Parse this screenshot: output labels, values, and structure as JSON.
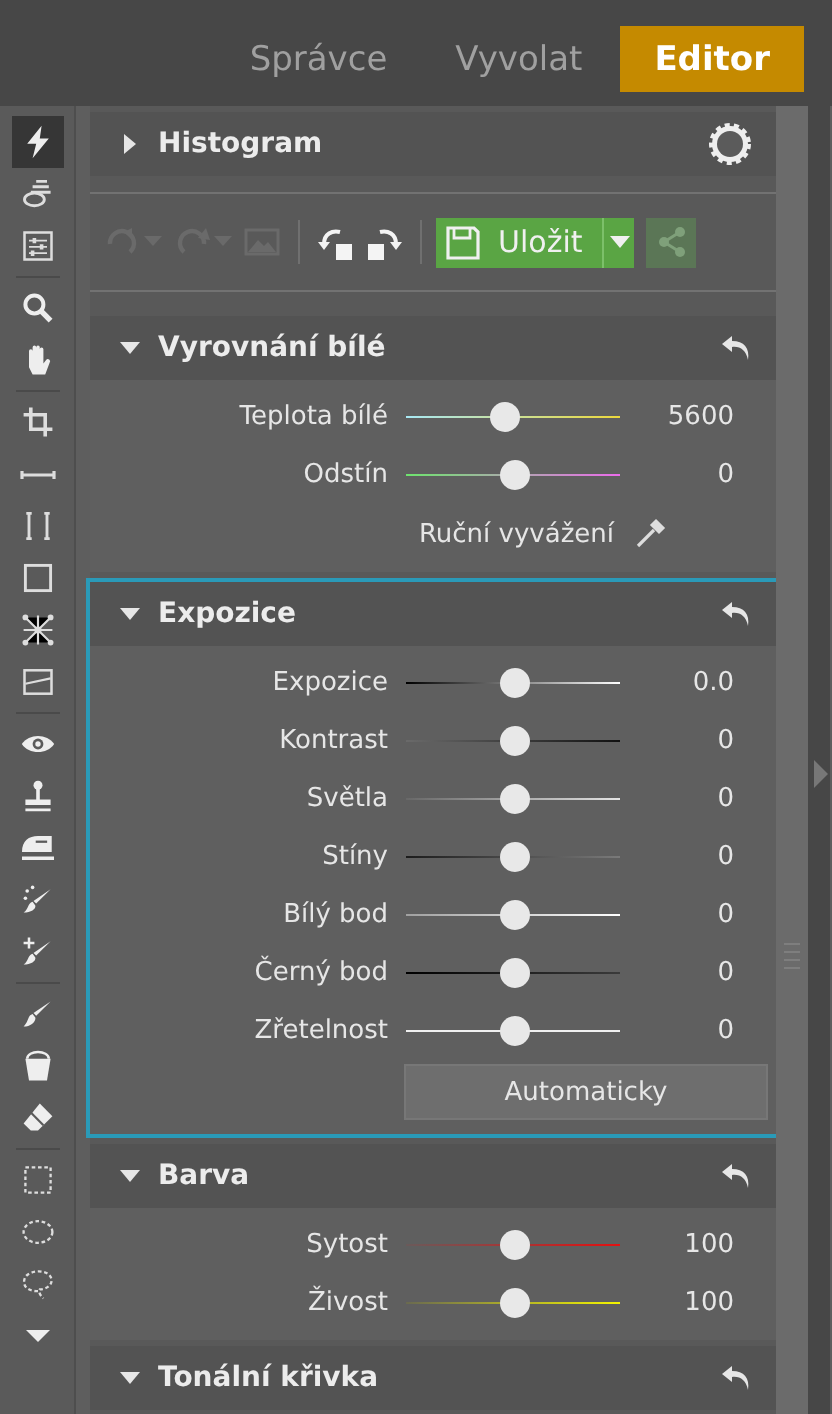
{
  "tabs": [
    {
      "label": "Správce",
      "selected": false
    },
    {
      "label": "Vyvolat",
      "selected": false
    },
    {
      "label": "Editor",
      "selected": true
    }
  ],
  "tools": [
    {
      "kind": "bolt",
      "selected": true
    },
    {
      "kind": "layers",
      "selected": false
    },
    {
      "kind": "sliders",
      "selected": false
    },
    {
      "kind": "separator"
    },
    {
      "kind": "search",
      "selected": false
    },
    {
      "kind": "hand",
      "selected": false
    },
    {
      "kind": "separator"
    },
    {
      "kind": "crop",
      "selected": false
    },
    {
      "kind": "line",
      "selected": false
    },
    {
      "kind": "brackets",
      "selected": false
    },
    {
      "kind": "rect",
      "selected": false
    },
    {
      "kind": "mesh",
      "selected": false
    },
    {
      "kind": "gradient",
      "selected": false
    },
    {
      "kind": "separator"
    },
    {
      "kind": "eye",
      "selected": false
    },
    {
      "kind": "stamp",
      "selected": false
    },
    {
      "kind": "iron",
      "selected": false
    },
    {
      "kind": "sparkbrush",
      "selected": false
    },
    {
      "kind": "plusbrush",
      "selected": false
    },
    {
      "kind": "separator"
    },
    {
      "kind": "brush",
      "selected": false
    },
    {
      "kind": "bucket",
      "selected": false
    },
    {
      "kind": "eraser",
      "selected": false
    },
    {
      "kind": "separator"
    },
    {
      "kind": "marquee",
      "selected": false
    },
    {
      "kind": "ellipse",
      "selected": false
    },
    {
      "kind": "lasso",
      "selected": false
    },
    {
      "kind": "more",
      "selected": false
    }
  ],
  "toolbar": {
    "buttons": [
      {
        "kind": "undo",
        "disabled": true
      },
      {
        "kind": "redo",
        "disabled": true
      },
      {
        "kind": "image",
        "disabled": true
      },
      {
        "kind": "rotleft",
        "disabled": false
      },
      {
        "kind": "rotright",
        "disabled": false
      }
    ],
    "save": {
      "label": "Uložit"
    },
    "share": {
      "disabled": true
    }
  },
  "sections": [
    {
      "kind": "histogram",
      "title": "Histogram",
      "expanded": false,
      "selected": false
    },
    {
      "kind": "adjust",
      "title": "Vyrovnání bílé",
      "expanded": true,
      "selected": false,
      "items": [
        {
          "kind": "temperature-slider",
          "label": "Teplota bílé",
          "level": 0.46,
          "reading": "5600"
        },
        {
          "kind": "tint-slider",
          "label": "Odstín",
          "level": 0.5,
          "reading": "0"
        },
        {
          "kind": "picker",
          "label": "Ruční vyvážení"
        }
      ]
    },
    {
      "kind": "adjust",
      "title": "Expozice",
      "expanded": true,
      "selected": true,
      "items": [
        {
          "kind": "exposure-slider",
          "label": "Expozice",
          "level": 0.5,
          "reading": "0.0"
        },
        {
          "kind": "contrast-slider",
          "label": "Kontrast",
          "level": 0.5,
          "reading": "0"
        },
        {
          "kind": "highlights-slider",
          "label": "Světla",
          "level": 0.5,
          "reading": "0"
        },
        {
          "kind": "shadows-slider",
          "label": "Stíny",
          "level": 0.5,
          "reading": "0"
        },
        {
          "kind": "whitepoint-slider",
          "label": "Bílý bod",
          "level": 0.5,
          "reading": "0"
        },
        {
          "kind": "blackpoint-slider",
          "label": "Černý bod",
          "level": 0.5,
          "reading": "0"
        },
        {
          "kind": "clarity-slider",
          "label": "Zřetelnost",
          "level": 0.5,
          "reading": "0"
        },
        {
          "kind": "button",
          "label": "Automaticky"
        }
      ]
    },
    {
      "kind": "adjust",
      "title": "Barva",
      "expanded": true,
      "selected": false,
      "items": [
        {
          "kind": "saturation-slider",
          "label": "Sytost",
          "level": 0.5,
          "reading": "100"
        },
        {
          "kind": "vibrance-slider",
          "label": "Živost",
          "level": 0.5,
          "reading": "100"
        }
      ]
    },
    {
      "kind": "adjust",
      "title": "Tonální křivka",
      "expanded": true,
      "selected": false
    }
  ]
}
